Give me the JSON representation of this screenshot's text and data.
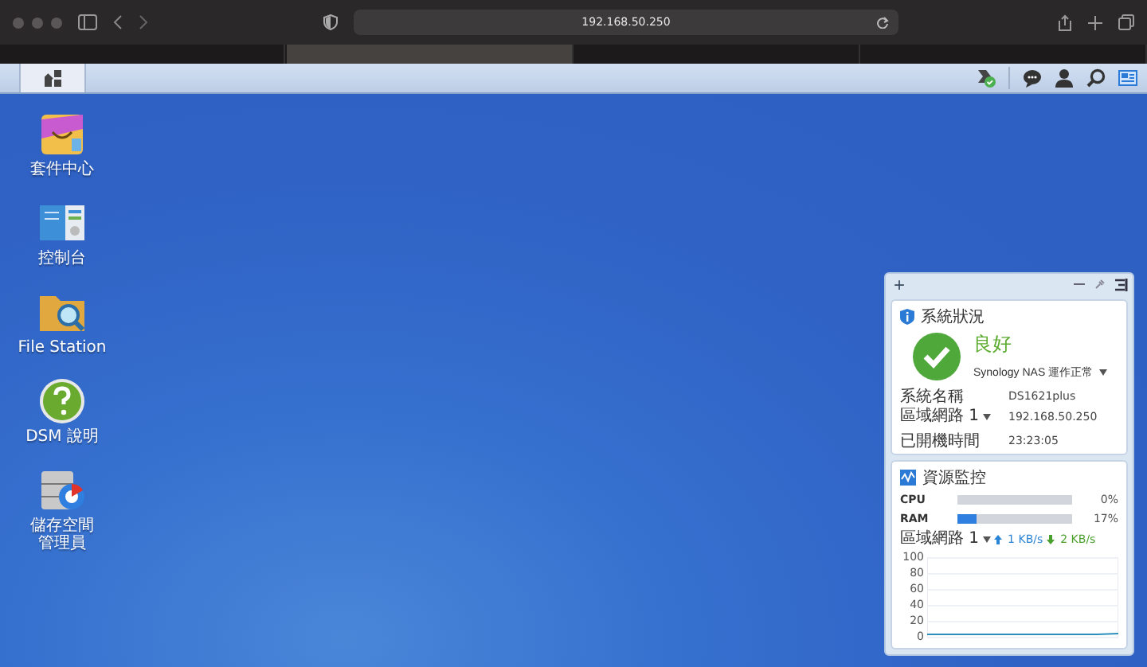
{
  "browser": {
    "address": "192.168.50.250",
    "tabs": [
      {
        "selected": false
      },
      {
        "selected": true
      },
      {
        "selected": false
      },
      {
        "selected": false
      }
    ]
  },
  "desktop_icons": [
    {
      "kind": "package",
      "label": "套件中心"
    },
    {
      "kind": "control",
      "label": "控制台"
    },
    {
      "kind": "folder",
      "label": "File Station"
    },
    {
      "kind": "help",
      "label": "DSM 說明"
    },
    {
      "kind": "storage",
      "label": "儲存空間管理員"
    }
  ],
  "widget": {
    "add": "+",
    "system_health": {
      "title": "系統狀況",
      "status": "良好",
      "message": "Synology NAS 運作正常",
      "rows": [
        {
          "label": "系統名稱",
          "dropdown": false,
          "value": "DS1621plus"
        },
        {
          "label": "區域網路 1",
          "dropdown": true,
          "value": "192.168.50.250"
        },
        {
          "label": "已開機時間",
          "dropdown": false,
          "value": "23:23:05"
        }
      ]
    },
    "resource_monitor": {
      "title": "資源監控",
      "meters": [
        {
          "label": "CPU",
          "level": 0,
          "reading": "0%"
        },
        {
          "label": "RAM",
          "level": 0.17,
          "reading": "17%"
        }
      ],
      "network": {
        "label": "區域網路 1",
        "upload": "1 KB/s",
        "download": "2 KB/s"
      },
      "chart_data": {
        "type": "line",
        "ylim": [
          0,
          100
        ],
        "yticks": [
          0,
          20,
          40,
          60,
          80,
          100
        ],
        "grid": true,
        "series": [
          {
            "color": "#2a8fbd",
            "values": [
              2,
              2,
              2,
              2,
              2,
              2,
              2,
              2,
              2,
              3
            ]
          }
        ]
      }
    }
  }
}
